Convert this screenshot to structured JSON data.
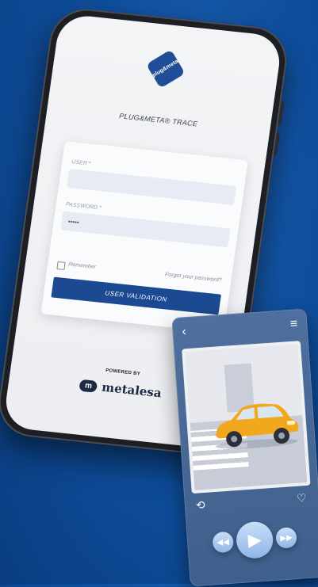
{
  "phone": {
    "logo_text": "plug&meta",
    "app_title": "PLUG&META® TRACE",
    "user_label": "USER *",
    "user_value": "",
    "password_label": "PASSWORD *",
    "password_value": "•••••",
    "remember_label": "Remember",
    "forgot_link": "Forgot your password?",
    "validate_button": "USER VALIDATION",
    "powered_by": "POWERED BY",
    "brand_mark": "m",
    "brand_name": "metalesa"
  },
  "mini_player": {
    "back_icon": "chevron-left-icon",
    "menu_icon": "hamburger-menu-icon",
    "loop_icon": "repeat-icon",
    "like_icon": "heart-icon",
    "rewind_icon": "rewind-icon",
    "play_icon": "play-icon",
    "forward_icon": "fast-forward-icon"
  },
  "colors": {
    "background": "#0f4f9e",
    "primary_button": "#1b4a92",
    "input_fill": "#e6ebf4",
    "car": "#f2a81c"
  }
}
